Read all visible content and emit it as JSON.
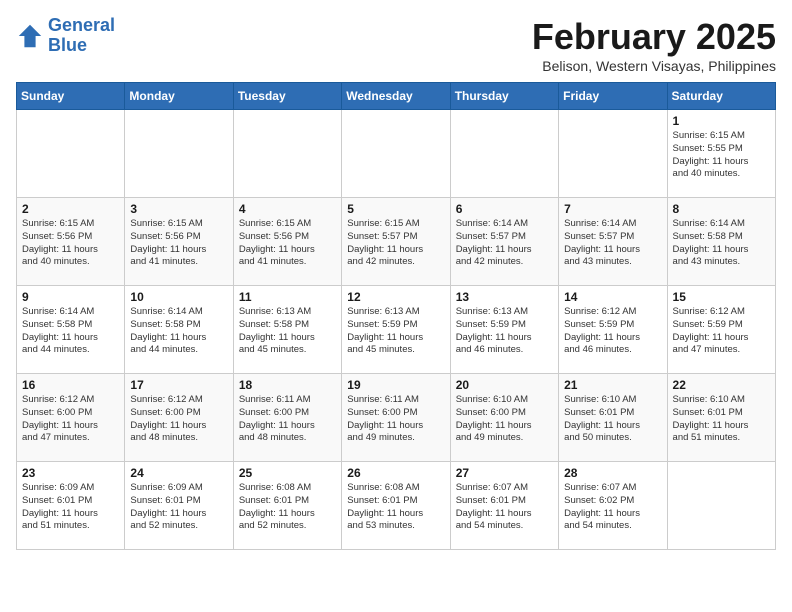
{
  "header": {
    "logo_line1": "General",
    "logo_line2": "Blue",
    "month_title": "February 2025",
    "location": "Belison, Western Visayas, Philippines"
  },
  "days_of_week": [
    "Sunday",
    "Monday",
    "Tuesday",
    "Wednesday",
    "Thursday",
    "Friday",
    "Saturday"
  ],
  "weeks": [
    [
      {
        "day": "",
        "info": ""
      },
      {
        "day": "",
        "info": ""
      },
      {
        "day": "",
        "info": ""
      },
      {
        "day": "",
        "info": ""
      },
      {
        "day": "",
        "info": ""
      },
      {
        "day": "",
        "info": ""
      },
      {
        "day": "1",
        "info": "Sunrise: 6:15 AM\nSunset: 5:55 PM\nDaylight: 11 hours\nand 40 minutes."
      }
    ],
    [
      {
        "day": "2",
        "info": "Sunrise: 6:15 AM\nSunset: 5:56 PM\nDaylight: 11 hours\nand 40 minutes."
      },
      {
        "day": "3",
        "info": "Sunrise: 6:15 AM\nSunset: 5:56 PM\nDaylight: 11 hours\nand 41 minutes."
      },
      {
        "day": "4",
        "info": "Sunrise: 6:15 AM\nSunset: 5:56 PM\nDaylight: 11 hours\nand 41 minutes."
      },
      {
        "day": "5",
        "info": "Sunrise: 6:15 AM\nSunset: 5:57 PM\nDaylight: 11 hours\nand 42 minutes."
      },
      {
        "day": "6",
        "info": "Sunrise: 6:14 AM\nSunset: 5:57 PM\nDaylight: 11 hours\nand 42 minutes."
      },
      {
        "day": "7",
        "info": "Sunrise: 6:14 AM\nSunset: 5:57 PM\nDaylight: 11 hours\nand 43 minutes."
      },
      {
        "day": "8",
        "info": "Sunrise: 6:14 AM\nSunset: 5:58 PM\nDaylight: 11 hours\nand 43 minutes."
      }
    ],
    [
      {
        "day": "9",
        "info": "Sunrise: 6:14 AM\nSunset: 5:58 PM\nDaylight: 11 hours\nand 44 minutes."
      },
      {
        "day": "10",
        "info": "Sunrise: 6:14 AM\nSunset: 5:58 PM\nDaylight: 11 hours\nand 44 minutes."
      },
      {
        "day": "11",
        "info": "Sunrise: 6:13 AM\nSunset: 5:58 PM\nDaylight: 11 hours\nand 45 minutes."
      },
      {
        "day": "12",
        "info": "Sunrise: 6:13 AM\nSunset: 5:59 PM\nDaylight: 11 hours\nand 45 minutes."
      },
      {
        "day": "13",
        "info": "Sunrise: 6:13 AM\nSunset: 5:59 PM\nDaylight: 11 hours\nand 46 minutes."
      },
      {
        "day": "14",
        "info": "Sunrise: 6:12 AM\nSunset: 5:59 PM\nDaylight: 11 hours\nand 46 minutes."
      },
      {
        "day": "15",
        "info": "Sunrise: 6:12 AM\nSunset: 5:59 PM\nDaylight: 11 hours\nand 47 minutes."
      }
    ],
    [
      {
        "day": "16",
        "info": "Sunrise: 6:12 AM\nSunset: 6:00 PM\nDaylight: 11 hours\nand 47 minutes."
      },
      {
        "day": "17",
        "info": "Sunrise: 6:12 AM\nSunset: 6:00 PM\nDaylight: 11 hours\nand 48 minutes."
      },
      {
        "day": "18",
        "info": "Sunrise: 6:11 AM\nSunset: 6:00 PM\nDaylight: 11 hours\nand 48 minutes."
      },
      {
        "day": "19",
        "info": "Sunrise: 6:11 AM\nSunset: 6:00 PM\nDaylight: 11 hours\nand 49 minutes."
      },
      {
        "day": "20",
        "info": "Sunrise: 6:10 AM\nSunset: 6:00 PM\nDaylight: 11 hours\nand 49 minutes."
      },
      {
        "day": "21",
        "info": "Sunrise: 6:10 AM\nSunset: 6:01 PM\nDaylight: 11 hours\nand 50 minutes."
      },
      {
        "day": "22",
        "info": "Sunrise: 6:10 AM\nSunset: 6:01 PM\nDaylight: 11 hours\nand 51 minutes."
      }
    ],
    [
      {
        "day": "23",
        "info": "Sunrise: 6:09 AM\nSunset: 6:01 PM\nDaylight: 11 hours\nand 51 minutes."
      },
      {
        "day": "24",
        "info": "Sunrise: 6:09 AM\nSunset: 6:01 PM\nDaylight: 11 hours\nand 52 minutes."
      },
      {
        "day": "25",
        "info": "Sunrise: 6:08 AM\nSunset: 6:01 PM\nDaylight: 11 hours\nand 52 minutes."
      },
      {
        "day": "26",
        "info": "Sunrise: 6:08 AM\nSunset: 6:01 PM\nDaylight: 11 hours\nand 53 minutes."
      },
      {
        "day": "27",
        "info": "Sunrise: 6:07 AM\nSunset: 6:01 PM\nDaylight: 11 hours\nand 54 minutes."
      },
      {
        "day": "28",
        "info": "Sunrise: 6:07 AM\nSunset: 6:02 PM\nDaylight: 11 hours\nand 54 minutes."
      },
      {
        "day": "",
        "info": ""
      }
    ]
  ]
}
